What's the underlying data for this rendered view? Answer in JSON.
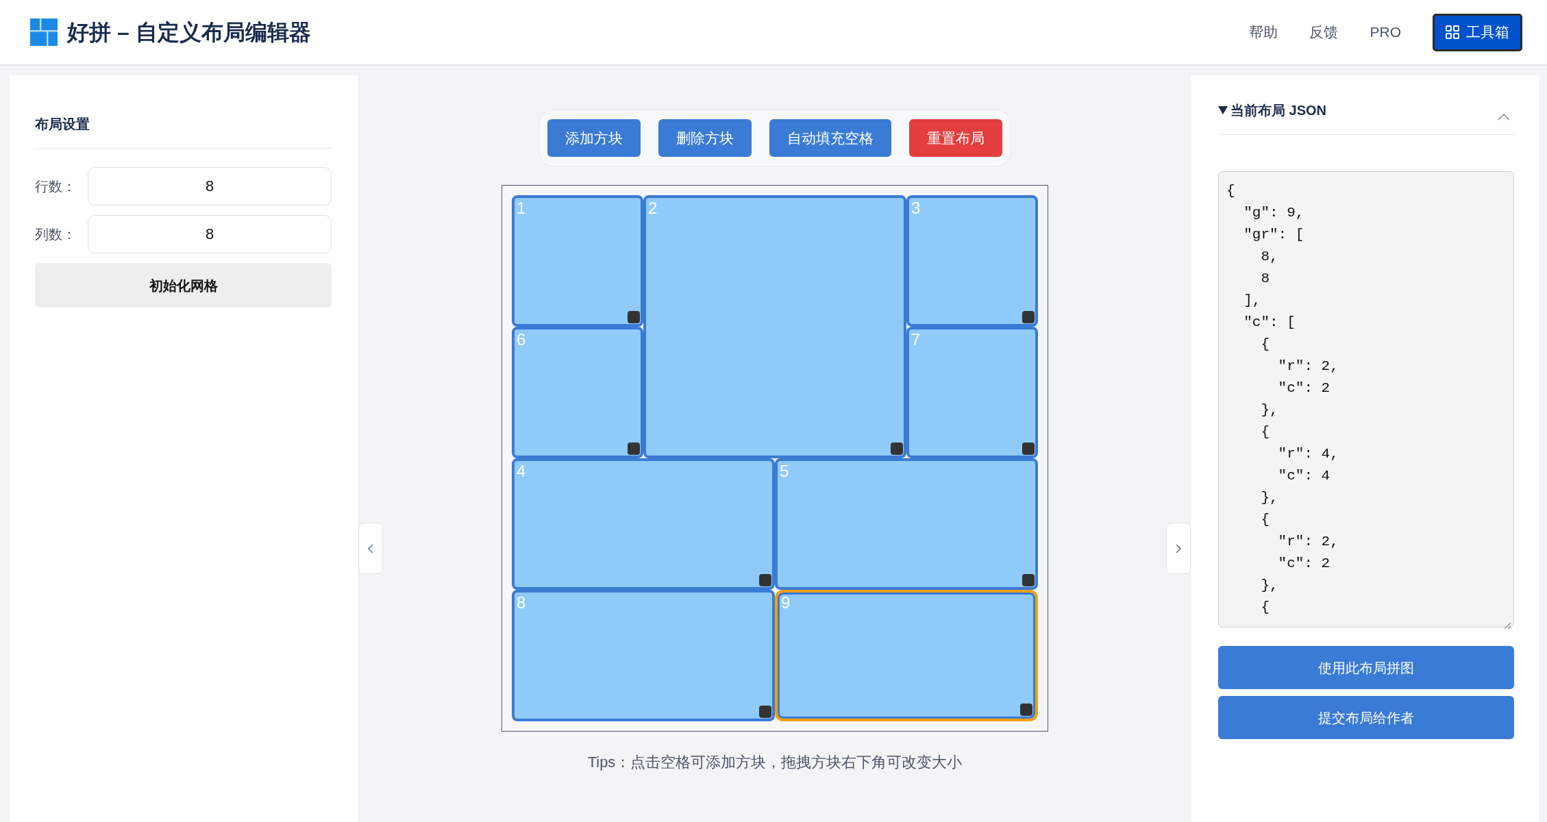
{
  "header": {
    "title": "好拼 – 自定义布局编辑器",
    "nav_links": [
      "帮助",
      "反馈",
      "PRO"
    ],
    "toolbox_button": {
      "label": "工具箱",
      "focused": true
    }
  },
  "settings": {
    "title": "布局设置",
    "fields": [
      {
        "label": "行数：",
        "value": "8"
      },
      {
        "label": "列数：",
        "value": "8"
      }
    ],
    "button": "初始化网格"
  },
  "toolbar": {
    "buttons": [
      {
        "label": "添加方块",
        "kind": "primary"
      },
      {
        "label": "删除方块",
        "kind": "primary"
      },
      {
        "label": "自动填充空格",
        "kind": "primary"
      },
      {
        "label": "重置布局",
        "kind": "danger"
      }
    ]
  },
  "grid": {
    "blocks": [
      {
        "label": "1",
        "kind": "small",
        "selected": false
      },
      {
        "label": "2",
        "kind": "large",
        "selected": false
      },
      {
        "label": "3",
        "kind": "small",
        "selected": false
      },
      {
        "label": "6",
        "kind": "small",
        "selected": false
      },
      {
        "label": "7",
        "kind": "small",
        "selected": false
      },
      {
        "label": "4",
        "kind": "wide",
        "selected": false
      },
      {
        "label": "5",
        "kind": "wide",
        "selected": false
      },
      {
        "label": "8",
        "kind": "wide",
        "selected": false
      },
      {
        "label": "9",
        "kind": "wide",
        "selected": true
      }
    ]
  },
  "tips": "Tips：点击空格可添加方块，拖拽方块右下角可改变大小",
  "json_panel": {
    "title": "当前布局 JSON",
    "expanded": true,
    "content": "{\n  \"g\": 9,\n  \"gr\": [\n    8,\n    8\n  ],\n  \"c\": [\n    {\n      \"r\": 2,\n      \"c\": 2\n    },\n    {\n      \"r\": 4,\n      \"c\": 4\n    },\n    {\n      \"r\": 2,\n      \"c\": 2\n    },\n    {",
    "buttons": [
      "使用此布局拼图",
      "提交布局给作者"
    ]
  }
}
